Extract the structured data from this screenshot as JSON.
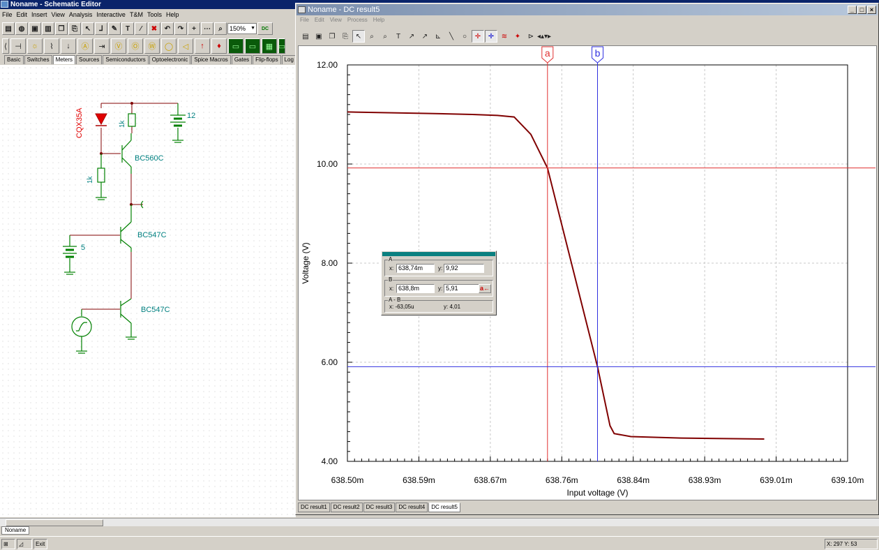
{
  "main_window": {
    "title": "Noname - Schematic Editor",
    "menu": [
      "File",
      "Edit",
      "Insert",
      "View",
      "Analysis",
      "Interactive",
      "T&M",
      "Tools",
      "Help"
    ],
    "zoom": "150%",
    "toolbar_dc_label": "DC",
    "component_tabs": [
      "Basic",
      "Switches",
      "Meters",
      "Sources",
      "Semiconductors",
      "Optoelectronic",
      "Spice Macros",
      "Gates",
      "Flip-flops",
      "Log"
    ],
    "active_component_tab": "Meters",
    "document_tab": "Noname",
    "status": {
      "exit": "Exit",
      "coords": "X: 297 Y: 53"
    }
  },
  "schematic": {
    "led_label": "CQX35A",
    "resistor_top": "1k",
    "resistor_left": "1k",
    "battery_top_value": "12",
    "battery_bottom_value": "5",
    "transistor_top": "BC560C",
    "transistor_mid": "BC547C",
    "transistor_bot": "BC547C"
  },
  "dc_window": {
    "title": "Noname - DC result5",
    "menu": [
      "File",
      "Edit",
      "View",
      "Process",
      "Help"
    ],
    "result_tabs": [
      "DC result1",
      "DC result2",
      "DC result3",
      "DC result4",
      "DC result5"
    ],
    "active_result_tab": "DC result5"
  },
  "chart_data": {
    "type": "line",
    "xlabel": "Input voltage (V)",
    "ylabel": "Voltage (V)",
    "xlim": [
      638.5,
      639.1
    ],
    "ylim": [
      4.0,
      12.0
    ],
    "x_unit_suffix": "m",
    "x_ticks": [
      "638.50m",
      "638.59m",
      "638.67m",
      "638.76m",
      "638.84m",
      "638.93m",
      "639.01m",
      "639.10m"
    ],
    "y_ticks": [
      "4.00",
      "6.00",
      "8.00",
      "10.00",
      "12.00"
    ],
    "grid": true,
    "series": [
      {
        "color": "#800000",
        "x": [
          638.5,
          638.6,
          638.65,
          638.68,
          638.7,
          638.72,
          638.74,
          638.8,
          638.815,
          638.82,
          638.84,
          638.9,
          639.0
        ],
        "y": [
          11.05,
          11.02,
          11.0,
          10.98,
          10.95,
          10.6,
          9.92,
          5.91,
          4.72,
          4.56,
          4.5,
          4.47,
          4.45
        ]
      }
    ],
    "cursors": [
      {
        "name": "a",
        "x": 638.74,
        "y": 9.92,
        "color": "#e03030"
      },
      {
        "name": "b",
        "x": 638.8,
        "y": 5.91,
        "color": "#3030e0"
      }
    ]
  },
  "readout": {
    "a_label": "A",
    "a_x_key": "x:",
    "a_x": "638,74m",
    "a_y_key": "y:",
    "a_y": "9,92",
    "b_label": "B",
    "b_x_key": "x:",
    "b_x": "638,8m",
    "b_y_key": "y:",
    "b_y": "5,91",
    "b_button": "a←",
    "diff_label": "A - B",
    "diff_x": "x:  -63,05u",
    "diff_y": "y:  4,01"
  }
}
